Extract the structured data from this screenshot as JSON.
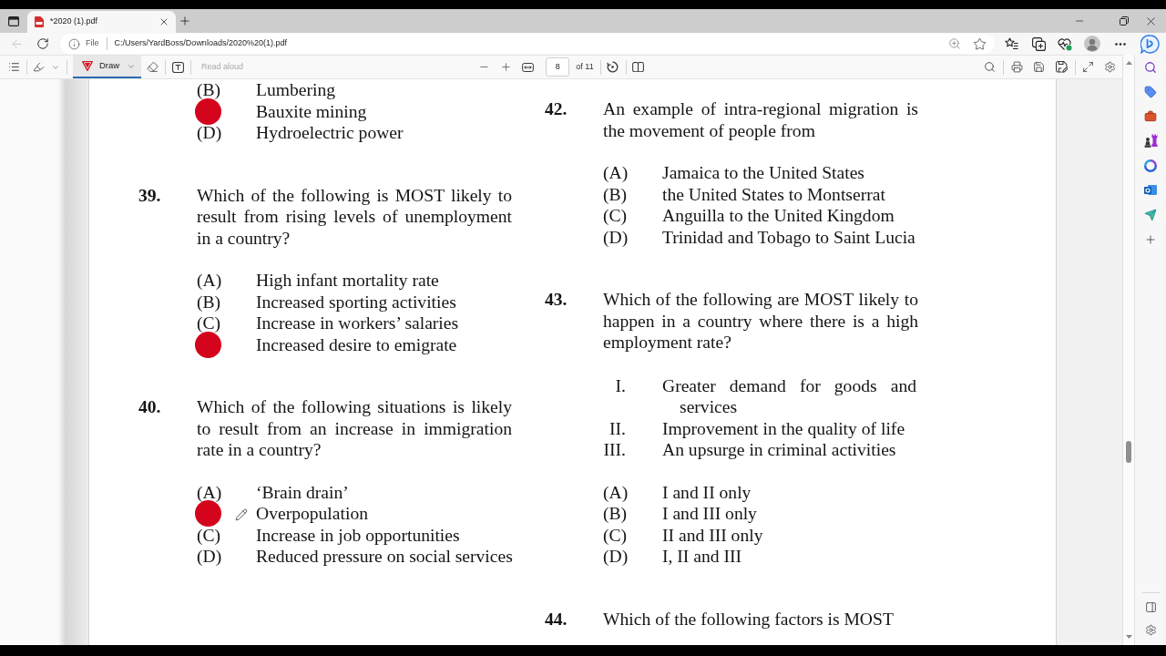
{
  "browser": {
    "tabs": [
      {
        "title": "*2020 (1).pdf",
        "selected": true
      }
    ],
    "navigation": {
      "back_disabled": true
    },
    "address_bar": {
      "scheme": "File",
      "url": "C:/Users/YardBoss/Downloads/2020%20(1).pdf"
    }
  },
  "pdf_toolbar": {
    "draw": {
      "label": "Draw",
      "selected": true
    },
    "read_aloud": {
      "label": "Read aloud",
      "disabled": true
    },
    "page": {
      "current": "8",
      "total": "of 11"
    }
  },
  "page": {
    "columns": [
      {
        "questions": [
          {
            "options": [
              {
                "letter": "(B)",
                "text": "Lumbering",
                "marked": false
              },
              {
                "text": "Bauxite mining",
                "marked": true
              },
              {
                "letter": "(D)",
                "text": "Hydroelectric power",
                "marked": false
              }
            ]
          },
          {
            "number": "39.",
            "text": "Which of the following is MOST likely to result from rising levels of unemployment in a country?",
            "options": [
              {
                "letter": "(A)",
                "text": "High infant mortality rate",
                "marked": false
              },
              {
                "letter": "(B)",
                "text": "Increased sporting activities",
                "marked": false
              },
              {
                "letter": "(C)",
                "text": "Increase in workers’ salaries",
                "marked": false
              },
              {
                "text": "Increased desire to emigrate",
                "marked": true
              }
            ]
          },
          {
            "number": "40.",
            "text": "Which of the following situations is likely to result from an increase in immigration rate in a country?",
            "options": [
              {
                "letter": "(A)",
                "text": "‘Brain drain’",
                "marked": false
              },
              {
                "text": "Overpopulation",
                "marked": true
              },
              {
                "letter": "(C)",
                "text": "Increase in job opportunities",
                "marked": false
              },
              {
                "letter": "(D)",
                "text": "Reduced pressure on social services",
                "marked": false
              }
            ]
          }
        ]
      },
      {
        "questions": [
          {
            "number": "42.",
            "text": "An example of intra-regional migration is the movement of people from",
            "options": [
              {
                "letter": "(A)",
                "text": "Jamaica to the United States",
                "marked": false
              },
              {
                "letter": "(B)",
                "text": "the United States to Montserrat",
                "marked": false
              },
              {
                "letter": "(C)",
                "text": "Anguilla to the United Kingdom",
                "marked": false
              },
              {
                "letter": "(D)",
                "text": "Trinidad and Tobago to Saint Lucia",
                "marked": false
              }
            ]
          },
          {
            "number": "43.",
            "text": "Which of the following are MOST likely to happen in a country where there is a high employment rate?",
            "statements": [
              {
                "numeral": "I.",
                "text": "Greater demand for goods and services"
              },
              {
                "numeral": "II.",
                "text": "Improvement in the quality of life"
              },
              {
                "numeral": "III.",
                "text": "An upsurge in criminal activities"
              }
            ],
            "options": [
              {
                "letter": "(A)",
                "text": "I and II only",
                "marked": false
              },
              {
                "letter": "(B)",
                "text": "I and III only",
                "marked": false
              },
              {
                "letter": "(C)",
                "text": "II and III only",
                "marked": false
              },
              {
                "letter": "(D)",
                "text": "I, II and III",
                "marked": false
              }
            ]
          },
          {
            "number": "44.",
            "text": "Which of the following factors is MOST"
          }
        ]
      }
    ]
  }
}
